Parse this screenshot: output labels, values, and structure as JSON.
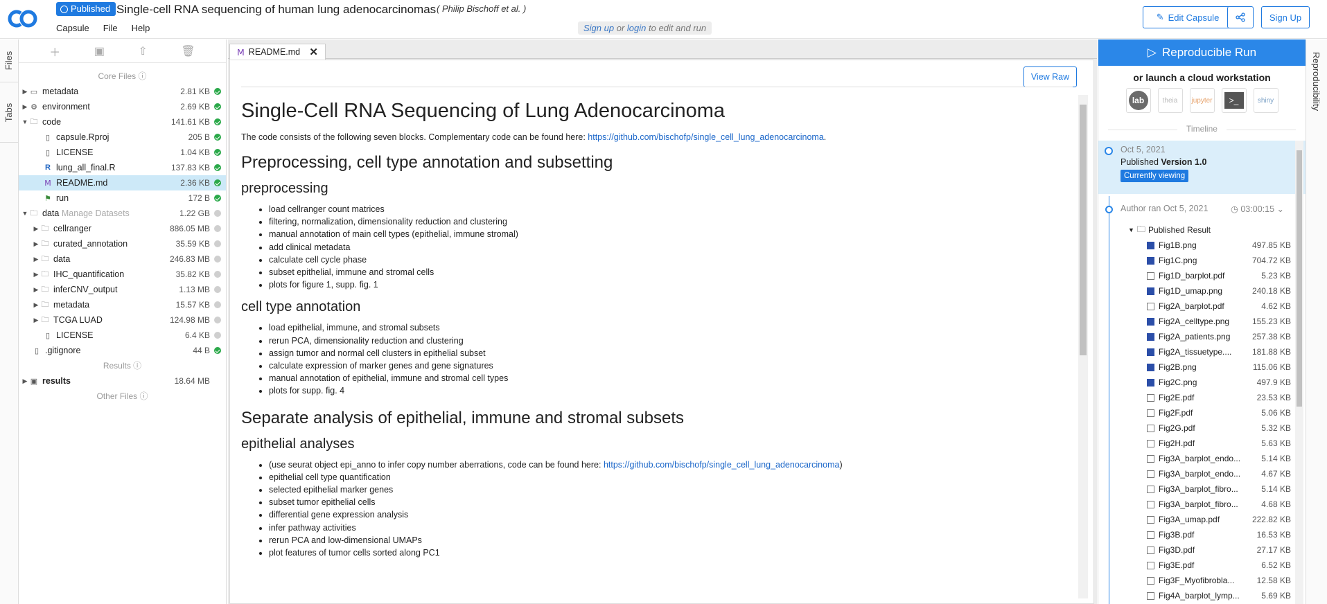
{
  "header": {
    "badge": "Published",
    "title": "Single-cell RNA sequencing of human lung adenocarcinomas",
    "authors": "( Philip Bischoff et al. )",
    "menu": [
      "Capsule",
      "File",
      "Help"
    ],
    "signup_link": "Sign up",
    "or_text": "or",
    "login_link": "login",
    "signup_suffix": "to edit and run",
    "edit_capsule": "Edit Capsule",
    "sign_up_btn": "Sign Up"
  },
  "left_rail": {
    "files_tab": "Files",
    "tabs_tab": "Tabs"
  },
  "files": {
    "core_files_label": "Core Files",
    "results_label": "Results",
    "other_files_label": "Other Files",
    "manage_datasets": "Manage Datasets",
    "items": [
      {
        "name": "metadata",
        "size": "2.81 KB"
      },
      {
        "name": "environment",
        "size": "2.69 KB"
      },
      {
        "name": "code",
        "size": "141.61 KB"
      },
      {
        "name": "capsule.Rproj",
        "size": "205 B"
      },
      {
        "name": "LICENSE",
        "size": "1.04 KB"
      },
      {
        "name": "lung_all_final.R",
        "size": "137.83 KB"
      },
      {
        "name": "README.md",
        "size": "2.36 KB"
      },
      {
        "name": "run",
        "size": "172 B"
      },
      {
        "name": "data",
        "size": "1.22 GB"
      },
      {
        "name": "cellranger",
        "size": "886.05 MB"
      },
      {
        "name": "curated_annotation",
        "size": "35.59 KB"
      },
      {
        "name": "data",
        "size": "246.83 MB"
      },
      {
        "name": "IHC_quantification",
        "size": "35.82 KB"
      },
      {
        "name": "inferCNV_output",
        "size": "1.13 MB"
      },
      {
        "name": "metadata",
        "size": "15.57 KB"
      },
      {
        "name": "TCGA LUAD",
        "size": "124.98 MB"
      },
      {
        "name": "LICENSE",
        "size": "6.4 KB"
      },
      {
        "name": ".gitignore",
        "size": "44 B"
      },
      {
        "name": "results",
        "size": "18.64 MB"
      }
    ]
  },
  "editor": {
    "tab_label": "README.md",
    "view_raw": "View Raw",
    "h1": "Single-Cell RNA Sequencing of Lung Adenocarcinoma",
    "intro": "The code consists of the following seven blocks. Complementary code can be found here: ",
    "intro_link": "https://github.com/bischofp/single_cell_lung_adenocarcinoma",
    "s1_h2": "Preprocessing, cell type annotation and subsetting",
    "s1a_h3": "preprocessing",
    "s1a_items": [
      "load cellranger count matrices",
      "filtering, normalization, dimensionality reduction and clustering",
      "manual annotation of main cell types (epithelial, immune stromal)",
      "add clinical metadata",
      "calculate cell cycle phase",
      "subset epithelial, immune and stromal cells",
      "plots for figure 1, supp. fig. 1"
    ],
    "s1b_h3": "cell type annotation",
    "s1b_items": [
      "load epithelial, immune, and stromal subsets",
      "rerun PCA, dimensionality reduction and clustering",
      "assign tumor and normal cell clusters in epithelial subset",
      "calculate expression of marker genes and gene signatures",
      "manual annotation of epithelial, immune and stromal cell types",
      "plots for supp. fig. 4"
    ],
    "s2_h2": "Separate analysis of epithelial, immune and stromal subsets",
    "s2a_h3": "epithelial analyses",
    "s2a_first": "(use seurat object epi_anno to infer copy number aberrations, code can be found here: ",
    "s2a_first_link": "https://github.com/bischofp/single_cell_lung_adenocarcinoma",
    "s2a_first_end": ")",
    "s2a_items": [
      "epithelial cell type quantification",
      "selected epithelial marker genes",
      "subset tumor epithelial cells",
      "differential gene expression analysis",
      "infer pathway activities",
      "rerun PCA and low-dimensional UMAPs",
      "plot features of tumor cells sorted along PC1"
    ]
  },
  "right_panel": {
    "run_btn": "Reproducible Run",
    "launch": "or launch a cloud workstation",
    "workstations": [
      "lab",
      "theia",
      "jupyter",
      "terminal",
      "shiny"
    ],
    "timeline_label": "Timeline",
    "tl1_date": "Oct 5, 2021",
    "tl1_prefix": "Published",
    "tl1_version": "Version 1.0",
    "tl1_badge": "Currently viewing",
    "tl2_text": "Author ran Oct 5, 2021",
    "tl2_time": "03:00:15",
    "result_folder": "Published Result",
    "results": [
      {
        "name": "Fig1B.png",
        "size": "497.85 KB",
        "type": "img"
      },
      {
        "name": "Fig1C.png",
        "size": "704.72 KB",
        "type": "img"
      },
      {
        "name": "Fig1D_barplot.pdf",
        "size": "5.23 KB",
        "type": "pdf"
      },
      {
        "name": "Fig1D_umap.png",
        "size": "240.18 KB",
        "type": "img"
      },
      {
        "name": "Fig2A_barplot.pdf",
        "size": "4.62 KB",
        "type": "pdf"
      },
      {
        "name": "Fig2A_celltype.png",
        "size": "155.23 KB",
        "type": "img"
      },
      {
        "name": "Fig2A_patients.png",
        "size": "257.38 KB",
        "type": "img"
      },
      {
        "name": "Fig2A_tissuetype....",
        "size": "181.88 KB",
        "type": "img"
      },
      {
        "name": "Fig2B.png",
        "size": "115.06 KB",
        "type": "img"
      },
      {
        "name": "Fig2C.png",
        "size": "497.9 KB",
        "type": "img"
      },
      {
        "name": "Fig2E.pdf",
        "size": "23.53 KB",
        "type": "pdf"
      },
      {
        "name": "Fig2F.pdf",
        "size": "5.06 KB",
        "type": "pdf"
      },
      {
        "name": "Fig2G.pdf",
        "size": "5.32 KB",
        "type": "pdf"
      },
      {
        "name": "Fig2H.pdf",
        "size": "5.63 KB",
        "type": "pdf"
      },
      {
        "name": "Fig3A_barplot_endo...",
        "size": "5.14 KB",
        "type": "pdf"
      },
      {
        "name": "Fig3A_barplot_endo...",
        "size": "4.67 KB",
        "type": "pdf"
      },
      {
        "name": "Fig3A_barplot_fibro...",
        "size": "5.14 KB",
        "type": "pdf"
      },
      {
        "name": "Fig3A_barplot_fibro...",
        "size": "4.68 KB",
        "type": "pdf"
      },
      {
        "name": "Fig3A_umap.pdf",
        "size": "222.82 KB",
        "type": "pdf"
      },
      {
        "name": "Fig3B.pdf",
        "size": "16.53 KB",
        "type": "pdf"
      },
      {
        "name": "Fig3D.pdf",
        "size": "27.17 KB",
        "type": "pdf"
      },
      {
        "name": "Fig3E.pdf",
        "size": "6.52 KB",
        "type": "pdf"
      },
      {
        "name": "Fig3F_Myofibrobla...",
        "size": "12.58 KB",
        "type": "pdf"
      },
      {
        "name": "Fig4A_barplot_lymp...",
        "size": "5.69 KB",
        "type": "pdf"
      }
    ]
  },
  "right_rail": {
    "tab": "Reproducibility"
  },
  "colors": {
    "accent": "#1f7ae0",
    "ok": "#2ba94a",
    "selected": "#cde9f8",
    "timeline_bg": "#dbeefa"
  }
}
